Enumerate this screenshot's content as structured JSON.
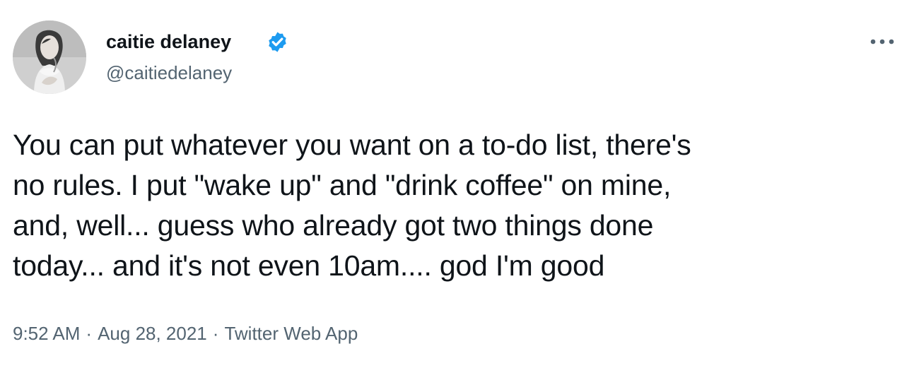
{
  "author": {
    "display_name": "caitie delaney",
    "handle": "@caitiedelaney",
    "verified_icon": "verified-badge-icon",
    "avatar_icon": "profile-photo"
  },
  "menu": {
    "more_icon": "more-horizontal-icon"
  },
  "tweet": {
    "text": "You can put whatever you want on a to-do list, there's\nno rules. I put \"wake up\" and \"drink coffee\" on mine,\nand, well... guess who already got two things done\ntoday... and it's not even 10am.... god I'm good"
  },
  "meta": {
    "time": "9:52 AM",
    "separator": "·",
    "date": "Aug 28, 2021",
    "source": "Twitter Web App"
  },
  "colors": {
    "text_primary": "#0f1419",
    "text_secondary": "#536471",
    "verified_blue": "#1d9bf0",
    "background": "#ffffff"
  }
}
